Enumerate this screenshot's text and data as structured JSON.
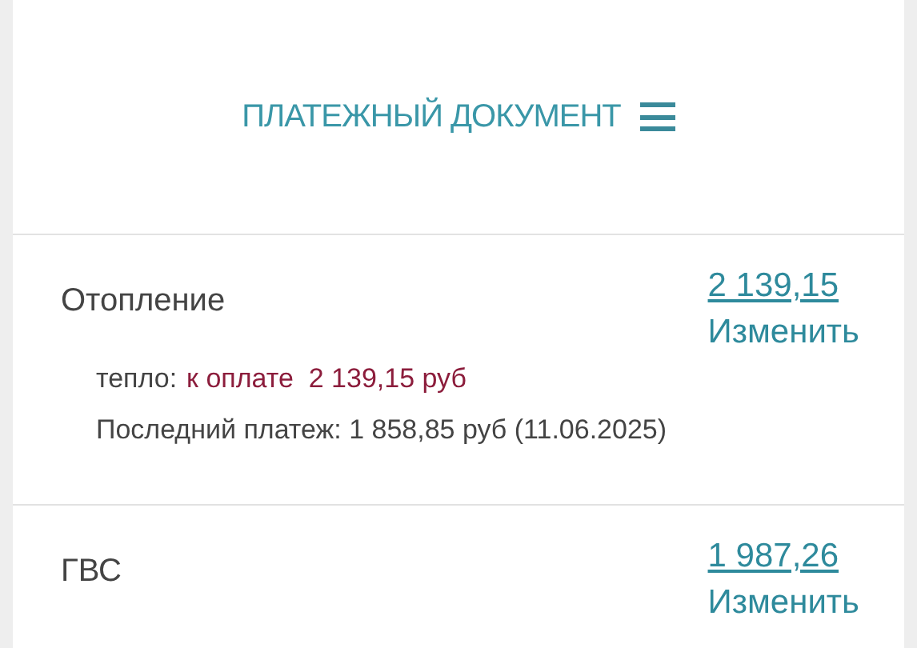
{
  "header": {
    "title": "ПЛАТЕЖНЫЙ ДОКУМЕНТ"
  },
  "services": [
    {
      "name": "Отопление",
      "amount": "2 139,15",
      "action": "Изменить",
      "details": [
        {
          "kind": "due",
          "label": "тепло:",
          "status": "к оплате",
          "value": "2 139,15 руб"
        },
        {
          "kind": "last",
          "text": "Последний платеж: 1 858,85 руб (11.06.2025)"
        }
      ]
    },
    {
      "name": "ГВС",
      "amount": "1 987,26",
      "action": "Изменить"
    }
  ]
}
